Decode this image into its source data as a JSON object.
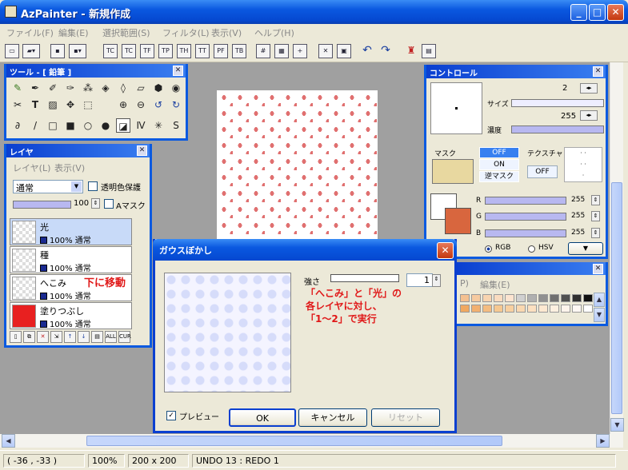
{
  "app": {
    "title": "AzPainter - 新規作成",
    "minimize_glyph": "_",
    "maximize_glyph": "□",
    "close_glyph": "✕"
  },
  "menu": [
    "ファイル(F)",
    "編集(E)",
    "選択範囲(S)",
    "フィルタ(L)",
    "表示(V)",
    "ヘルプ(H)"
  ],
  "toolbar_labels": [
    "TC",
    "TC",
    "TF",
    "TP",
    "TH",
    "TT",
    "PF",
    "TB"
  ],
  "tool_panel": {
    "title": "ツール - [ 鉛筆 ]"
  },
  "layer_panel": {
    "title": "レイヤ",
    "menu": [
      "レイヤ(L)",
      "表示(V)"
    ],
    "blend_mode": "通常",
    "lock_alpha_label": "透明色保護",
    "opacity": "100",
    "amask_label": "Aマスク",
    "layers": [
      {
        "name": "光",
        "info": "100% 通常"
      },
      {
        "name": "種",
        "info": "100% 通常"
      },
      {
        "name": "へこみ",
        "info": "100% 通常"
      },
      {
        "name": "塗りつぶし",
        "info": "100% 通常"
      }
    ],
    "btn_all": "ALL",
    "btn_cur": "CUR"
  },
  "control_panel": {
    "title": "コントロール",
    "size_label": "サイズ",
    "size_value": "2",
    "density_label": "濃度",
    "density_value": "255",
    "mask_label": "マスク",
    "mask_off": "OFF",
    "mask_on": "ON",
    "mask_reverse": "逆マスク",
    "texture_label": "テクスチャ",
    "texture_off": "OFF",
    "r_label": "R",
    "g_label": "G",
    "b_label": "B",
    "r_value": "255",
    "g_value": "255",
    "b_value": "255",
    "rgb_label": "RGB",
    "hsv_label": "HSV",
    "color_mode_selected": "RGB",
    "fg_color": "#ffffff",
    "bg_color": "#d8663e"
  },
  "palette_panel": {
    "menu": [
      "P)",
      "編集(E)"
    ]
  },
  "dialog": {
    "title": "ガウスぼかし",
    "strength_label": "強さ",
    "strength_value": "1",
    "preview_label": "プレビュー",
    "ok": "OK",
    "cancel": "キャンセル",
    "reset": "リセット"
  },
  "annotations": {
    "move_down": "下に移動",
    "instruction_line1": "「へこみ」と「光」の",
    "instruction_line2": "各レイヤに対し、",
    "instruction_line3": "「1～2」で実行"
  },
  "status": {
    "coords": "( -36 , -33 )",
    "zoom": "100%",
    "size": "200 x 200",
    "undo": "UNDO 13 : REDO 1"
  },
  "colors": {
    "titlebar": "#0a58e0",
    "panel_border": "#0a5ae0",
    "annotation": "#e01818",
    "dialog_accent": "#0a3fd0"
  }
}
